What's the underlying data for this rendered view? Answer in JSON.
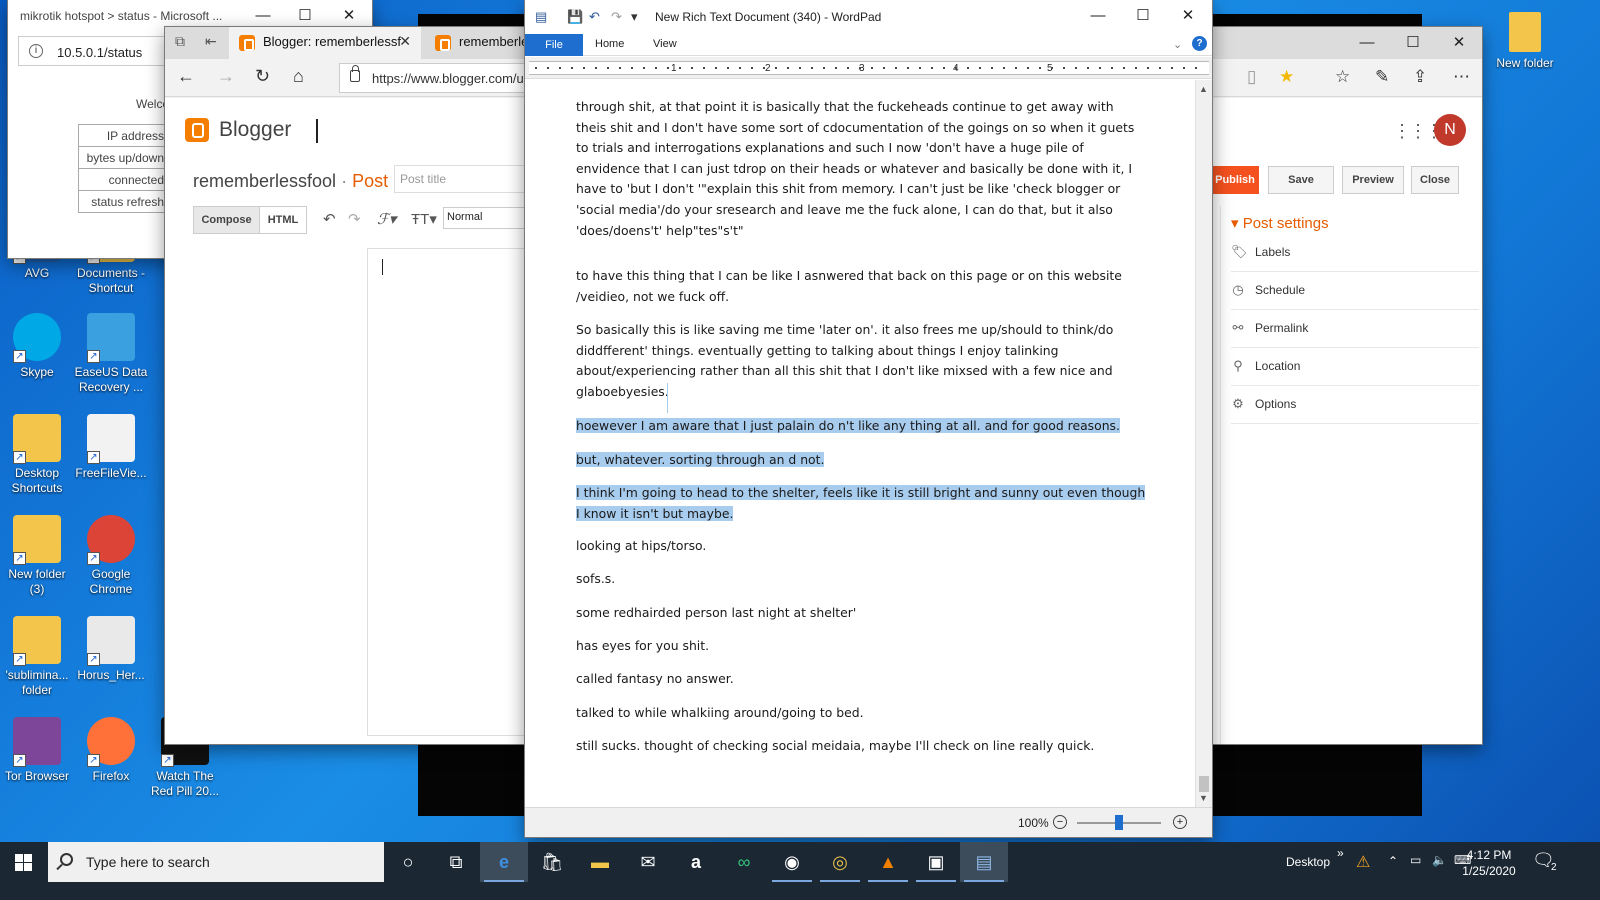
{
  "desktop": {
    "icons_left": [
      {
        "label": "AVG",
        "icon": "avg-icon"
      },
      {
        "label": "Skype",
        "icon": "skype-icon"
      },
      {
        "label": "Desktop Shortcuts",
        "icon": "folder-icon"
      },
      {
        "label": "New folder (3)",
        "icon": "folder-icon"
      },
      {
        "label": "'sublimina... folder",
        "icon": "folder-icon"
      },
      {
        "label": "Tor Browser",
        "icon": "tor-icon"
      }
    ],
    "icons_col2": [
      {
        "label": "Documents - Shortcut",
        "icon": "folder-icon"
      },
      {
        "label": "EaseUS Data Recovery ...",
        "icon": "easeus-icon"
      },
      {
        "label": "FreeFileVie...",
        "icon": "file-icon"
      },
      {
        "label": "Google Chrome",
        "icon": "chrome-icon"
      },
      {
        "label": "Horus_Her...",
        "icon": "pdf-icon"
      },
      {
        "label": "Firefox",
        "icon": "firefox-icon"
      }
    ],
    "icons_col3": [
      {
        "label": "Watch The Red Pill 20...",
        "icon": "video-icon"
      }
    ],
    "icon_right": {
      "label": "New folder",
      "icon": "folder-icon"
    }
  },
  "mikrotik": {
    "title": "mikrotik hotspot > status - Microsoft ...",
    "url": "10.5.0.1/status",
    "welcome": "Welco",
    "rows": [
      "IP address",
      "bytes up/down",
      "connected",
      "status refresh"
    ]
  },
  "blogger_browser": {
    "tabs": [
      {
        "label": "Blogger: rememberlessf",
        "active": true
      },
      {
        "label": "rememberle",
        "active": false
      }
    ],
    "url": "https://www.blogger.com/u",
    "app_name": "Blogger",
    "avatar_letter": "N",
    "blog_name": "rememberlessfool",
    "separator": "·",
    "post_label": "Post",
    "post_title_placeholder": "Post title",
    "buttons": {
      "publish": "Publish",
      "save": "Save",
      "preview": "Preview",
      "close": "Close"
    },
    "modes": {
      "compose": "Compose",
      "html": "HTML"
    },
    "format_select": "Normal",
    "post_settings": {
      "heading": "Post settings",
      "items": [
        "Labels",
        "Schedule",
        "Permalink",
        "Location",
        "Options"
      ]
    }
  },
  "wordpad": {
    "title": "New Rich Text Document (340) - WordPad",
    "ribbon_tabs": {
      "file": "File",
      "home": "Home",
      "view": "View"
    },
    "ruler_numbers": [
      "1",
      "2",
      "3",
      "4",
      "5"
    ],
    "paragraphs": [
      {
        "text": "through shit, at that point it is basically that the fuckeheads continue to get away with theis shit and I don't have some sort of cdocumentation of the goings on so when it guets to trials and interrogations explanations and such I now 'don't have a huge pile of envidence that I can just tdrop on their heads or whatever and basically be done with it, I have to 'but I don't '\"explain this shit from memory. I can't just be like 'check blogger or 'social media'/do your sresearch and leave me the fuck alone, I can do that, but it also 'does/doens't' help\"tes\"s't\"",
        "selected": false
      },
      {
        "text": " to have this thing that I can be like I asnwered that back on this page or on this website /veidieo, not we  fuck off.",
        "selected": false
      },
      {
        "text": "So basically this is like saving me time 'later on'. it also frees me up/should to think/do diddfferent' things. eventually getting to talking about things I enjoy talinking about/experiencing rather than all this shit that I don't like mixsed with a few nice and glaboebyesies.",
        "selected": false
      },
      {
        "text": "hoewever I am aware that I just palain do n't like any thing at all. and for good reasons.",
        "selected": true
      },
      {
        "text": "but, whatever. sorting through an d not.",
        "selected": true
      },
      {
        "text": "I think I'm going to head to the shelter, feels like it is still bright and sunny out even though I know it isn't but maybe.",
        "selected": true
      },
      {
        "text": "looking at hips/torso.",
        "selected": false
      },
      {
        "text": "sofs.s.",
        "selected": false
      },
      {
        "text": "some redhairded person last night at shelter'",
        "selected": false
      },
      {
        "text": "has eyes for you shit.",
        "selected": false
      },
      {
        "text": "called fantasy no answer.",
        "selected": false
      },
      {
        "text": "talked to while whalkiing around/going to bed.",
        "selected": false
      },
      {
        "text": "still sucks. thought of checking social meidaia, maybe I'll check on line really quick.",
        "selected": false
      }
    ],
    "zoom": "100%",
    "zoom_level_fraction": 0.5
  },
  "taskbar": {
    "search_placeholder": "Type here to search",
    "desktop_label": "Desktop",
    "time": "4:12 PM",
    "date": "1/25/2020",
    "notification_count": "2"
  },
  "colors": {
    "wordpad_selection": "#a8ccee",
    "blogger_orange": "#f57d00",
    "publish": "#f4511e",
    "file_tab": "#1e6ecf",
    "taskbar": "#1b2732"
  }
}
